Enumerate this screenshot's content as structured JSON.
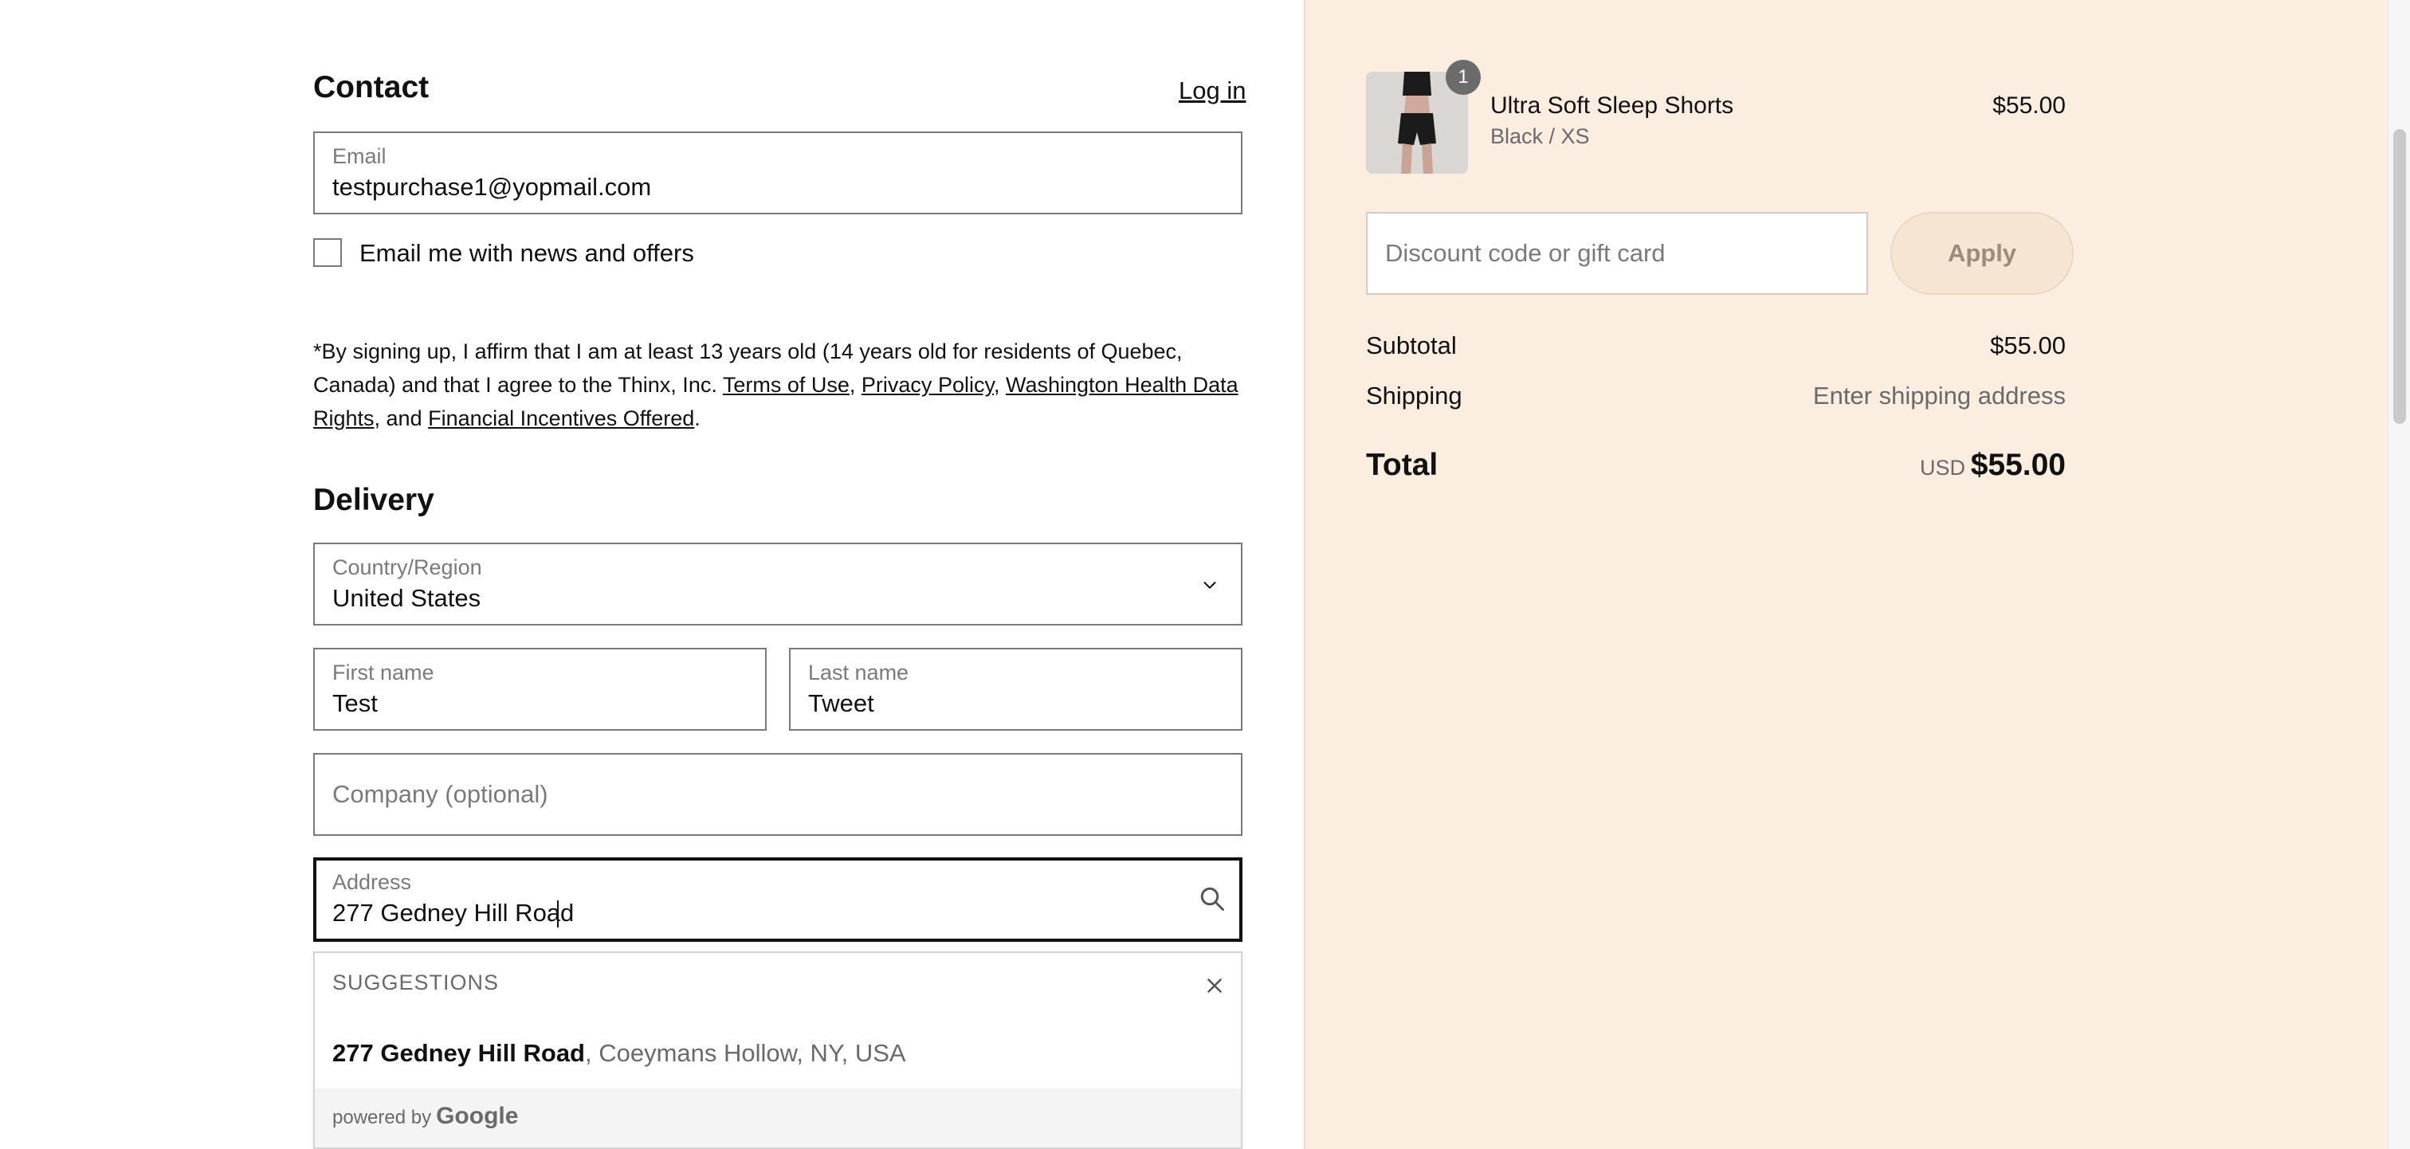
{
  "contact": {
    "heading": "Contact",
    "login_link": "Log in",
    "email_label": "Email",
    "email_value": "testpurchase1@yopmail.com",
    "marketing_checkbox_label": "Email me with news and offers",
    "legal": {
      "prefix": "*By signing up, I affirm that I am at least 13 years old (14 years old for residents of Quebec, Canada) and that I agree to the Thinx, Inc.",
      "terms": "Terms of Use",
      "privacy": "Privacy Policy",
      "washington": "Washington Health Data Rights",
      "and_word": ", and",
      "financial": "Financial Incentives Offered"
    }
  },
  "delivery": {
    "heading": "Delivery",
    "country_label": "Country/Region",
    "country_value": "United States",
    "first_name_label": "First name",
    "first_name_value": "Test",
    "last_name_label": "Last name",
    "last_name_value": "Tweet",
    "company_placeholder": "Company (optional)",
    "address_label": "Address",
    "address_value": "277 Gedney Hill Road",
    "suggestions": {
      "header": "SUGGESTIONS",
      "item_main": "277 Gedney Hill Road",
      "item_rest": ", Coeymans Hollow, NY, USA",
      "powered_by": "powered by",
      "google": "Google"
    }
  },
  "summary": {
    "product_name": "Ultra Soft Sleep Shorts",
    "variant": "Black / XS",
    "quantity_badge": "1",
    "product_price": "$55.00",
    "discount_placeholder": "Discount code or gift card",
    "apply_label": "Apply",
    "subtotal_label": "Subtotal",
    "subtotal_value": "$55.00",
    "shipping_label": "Shipping",
    "shipping_value": "Enter shipping address",
    "total_label": "Total",
    "currency": "USD",
    "total_value": "$55.00"
  },
  "icons": {
    "chevron": "chevron-down-icon",
    "search": "search-icon",
    "close": "close-icon"
  }
}
